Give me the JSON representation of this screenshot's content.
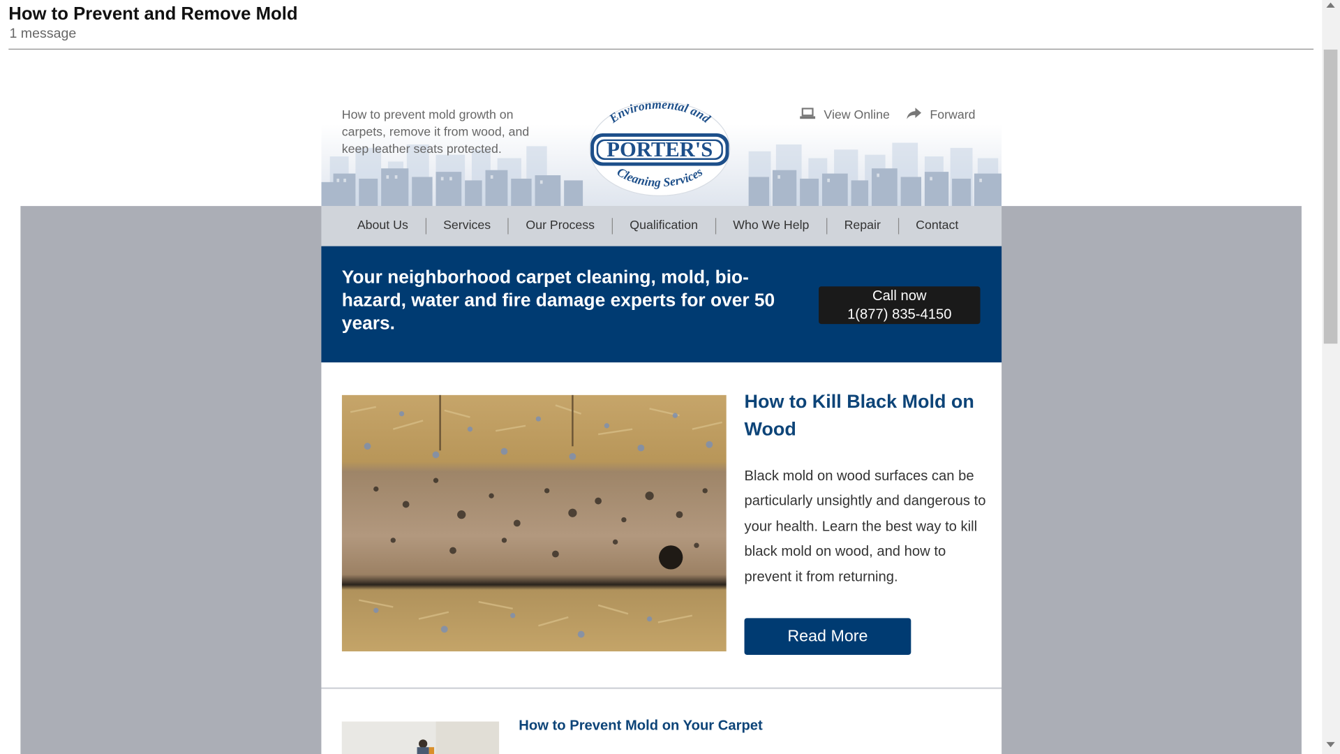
{
  "message": {
    "subject": "How to Prevent and Remove Mold",
    "count": "1 message"
  },
  "header": {
    "preheader": "How to prevent mold growth on carpets, remove it from wood, and keep leather seats protected.",
    "view_online": "View Online",
    "forward": "Forward",
    "logo": {
      "top_text": "Environmental and",
      "name": "PORTER'S",
      "bottom_text": "Cleaning Services"
    }
  },
  "nav": [
    "About Us",
    "Services",
    "Our Process",
    "Qualification",
    "Who We Help",
    "Repair",
    "Contact"
  ],
  "banner": {
    "text": "Your neighborhood carpet cleaning, mold, bio-hazard, water and fire damage experts for over 50 years.",
    "call_line1": "Call now",
    "call_line2": "1(877) 835-4150"
  },
  "article1": {
    "title": "How to Kill Black Mold on Wood",
    "body": "Black mold on wood surfaces can be particularly unsightly and dangerous to your health. Learn the best way to kill black mold on wood, and how to prevent it from returning.",
    "button": "Read More"
  },
  "article2": {
    "title": "How to Prevent Mold on Your Carpet"
  },
  "colors": {
    "brand_navy": "#003b72",
    "title_blue": "#0d4478",
    "nav_bg": "#d0d4da",
    "outer_bg": "#abaeb6",
    "call_bg": "#1a1a1a"
  },
  "icons": [
    "laptop-icon",
    "forward-arrow-icon"
  ]
}
